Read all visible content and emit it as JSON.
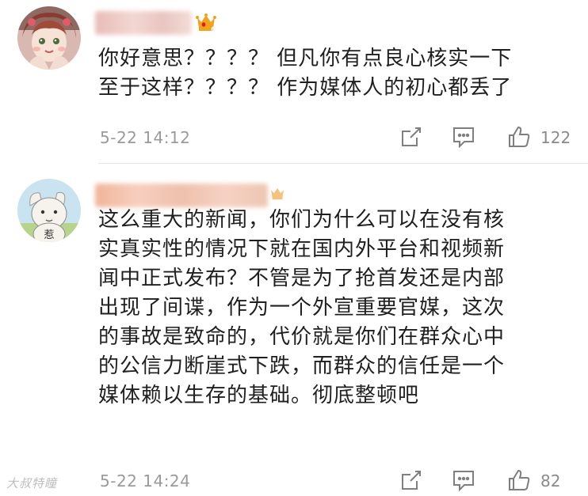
{
  "comments": [
    {
      "content": "你好意思？？？？ 但凡你有点良心核实一下\n至于这样？？？？ 作为媒体人的初心都丢了",
      "timestamp": "5-22 14:12",
      "likes": "122",
      "vip_badge": "6"
    },
    {
      "avatar_text": "惹",
      "content": "这么重大的新闻，你们为什么可以在没有核\n实真实性的情况下就在国内外平台和视频新\n闻中正式发布？不管是为了抢首发还是内部\n出现了间谍，作为一个外宣重要官媒，这次\n的事故是致命的，代价就是你们在群众心中\n的公信力断崖式下跌，而群众的信任是一个\n媒体赖以生存的基础。彻底整顿吧",
      "timestamp": "5-22 14:24",
      "likes": "82"
    }
  ],
  "watermark": "大叔特瞳",
  "icons": {
    "share": "share-icon",
    "reply": "comment-icon",
    "like": "thumbs-up-icon",
    "vip": "crown-icon"
  },
  "colors": {
    "text": "#1f1f1f",
    "meta": "#9a9a9a",
    "vip": "#f5a623",
    "divider": "#e6e6e6"
  }
}
